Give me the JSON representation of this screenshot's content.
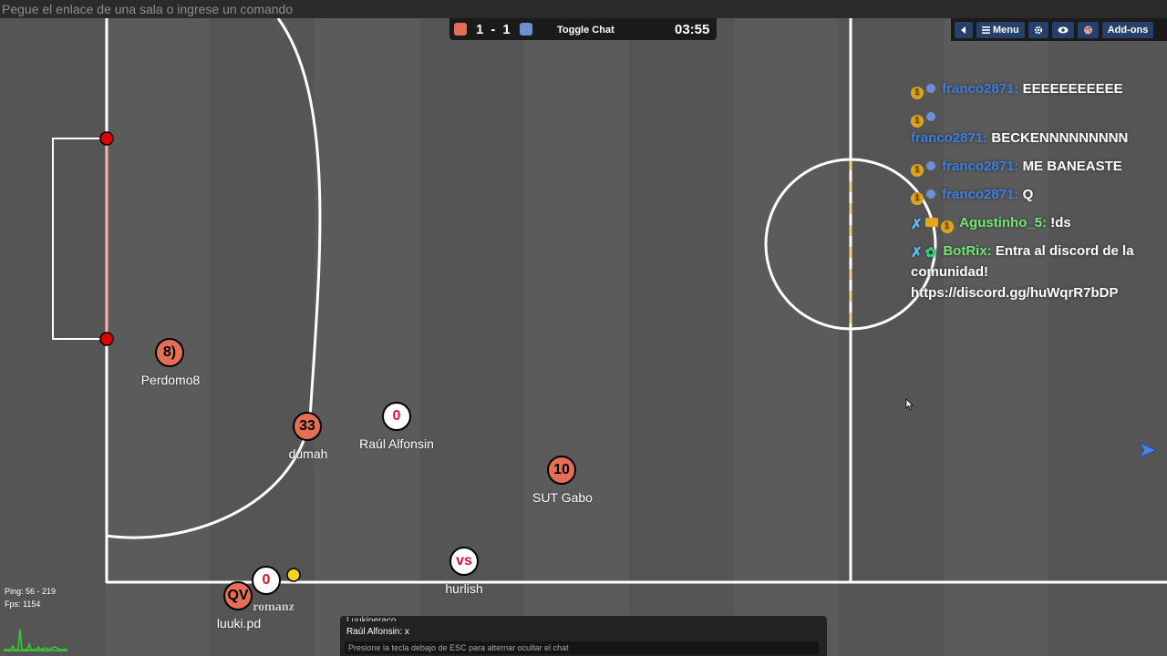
{
  "url_bar": {
    "placeholder": "Pegue el enlace de una sala o ingrese un comando"
  },
  "scoreboard": {
    "red_score": "1",
    "separator": "-",
    "blue_score": "1",
    "toggle_chat_label": "Toggle Chat",
    "timer": "03:55",
    "red_color": "#e56e56",
    "blue_color": "#6c8fd6"
  },
  "topbar": {
    "back_icon": "triangle-left-icon",
    "menu_label": "Menu",
    "settings_icon": "gear-icon",
    "view_icon": "eye-icon",
    "palette_icon": "palette-icon",
    "addons_label": "Add-ons"
  },
  "players": [
    {
      "number": "8)",
      "name": "Perdomo8",
      "team": "red"
    },
    {
      "number": "33",
      "name": "dumah",
      "team": "red"
    },
    {
      "number": "0",
      "name": "Raúl Alfonsin",
      "team": "white"
    },
    {
      "number": "10",
      "name": "SUT Gabo",
      "team": "red"
    },
    {
      "number": "vs",
      "name": "hurlish",
      "team": "white"
    },
    {
      "number": "QV",
      "name": "luuki.pd",
      "team": "red"
    },
    {
      "number": "0",
      "name": "romanz",
      "team": "white"
    }
  ],
  "chat": {
    "messages": [
      {
        "author": "franco2871:",
        "text": "EEEEEEEEEEE"
      },
      {
        "author": "franco2871:",
        "text": "BECKENNNNNNNNN"
      },
      {
        "author": "franco2871:",
        "text": "ME BANEASTE"
      },
      {
        "author": "franco2871:",
        "text": "Q"
      },
      {
        "author": "Agustinho_5:",
        "text": "!ds"
      },
      {
        "author": "BotRix:",
        "text": "Entra al discord de la comunidad! https://discord.gg/huWqrR7bDP"
      }
    ]
  },
  "stats": {
    "ping": "Ping: 56 - 219",
    "fps": "Fps: 1154"
  },
  "bottom_chat": {
    "line_1": "Luukiperaco",
    "line_2": "Raúl Alfonsin: x",
    "input_placeholder": "Presione la tecla debajo de ESC para alternar ocultar el chat"
  },
  "colors": {
    "field": "#5b5b5b",
    "lines": "#ffffff",
    "goal_post": "#e00000",
    "ball": "#f2d41a",
    "kickoff_dash": "#e9d58a"
  }
}
